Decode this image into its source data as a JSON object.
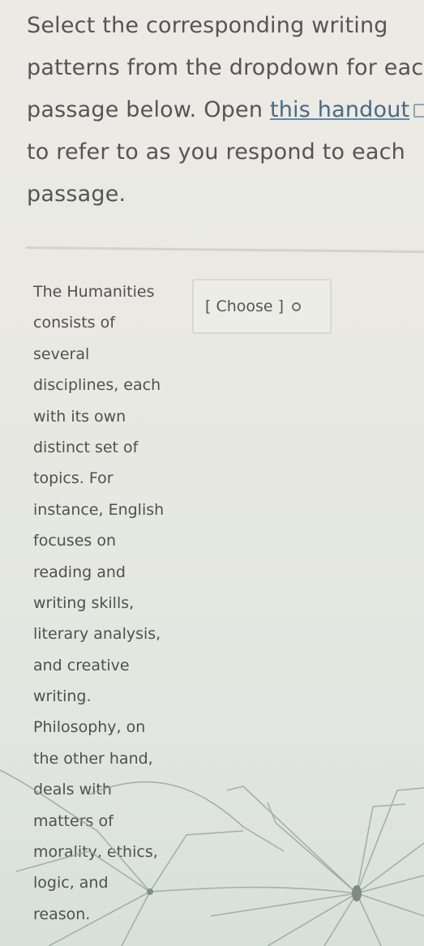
{
  "instructions": {
    "lines": [
      "Select the corresponding writing",
      "patterns from the dropdown for eacl",
      "passage below. Open ",
      "to refer to as you respond to each",
      "passage."
    ],
    "link_text": "this handout",
    "link_icon": "external-link-icon"
  },
  "question": {
    "passage_lines": [
      "The Humanities",
      "consists of",
      "several",
      "disciplines, each",
      "with its own",
      "distinct set of",
      "topics. For",
      "instance, English",
      "focuses on",
      "reading and",
      "writing skills,",
      "literary analysis,",
      "and creative",
      "writing.",
      "Philosophy, on",
      "the other hand,",
      "deals with",
      "matters of",
      "morality, ethics,",
      "logic, and",
      "reason."
    ],
    "dropdown": {
      "selected": "[ Choose ]",
      "icon": "chevron-updown-icon"
    }
  }
}
